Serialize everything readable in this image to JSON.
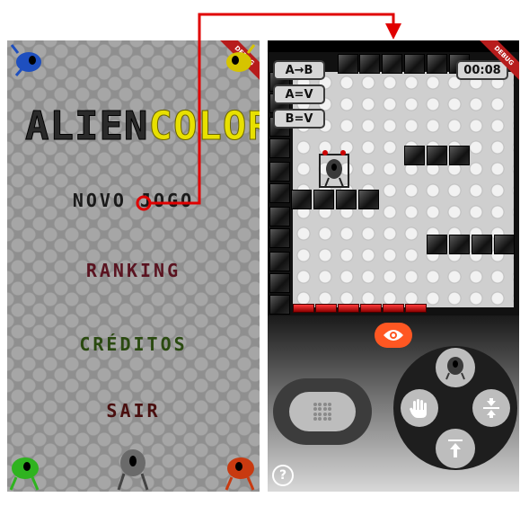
{
  "menu": {
    "logo_part1": "ALIEN",
    "logo_part2": "COLORS",
    "items": [
      {
        "label": "NOVO JOGO",
        "color": "#1a1a1a"
      },
      {
        "label": "RANKING",
        "color": "#5a1320"
      },
      {
        "label": "CRÉDITOS",
        "color": "#2a4a10"
      },
      {
        "label": "SAIR",
        "color": "#4a0f0f"
      }
    ],
    "debug_label": "DEBUG"
  },
  "game": {
    "rules": [
      "A→B",
      "A=V",
      "B=V"
    ],
    "timer": "00:08",
    "debug_label": "DEBUG"
  },
  "controls": {
    "view_icon": "eye-icon",
    "toggle_icon": "dots-icon",
    "grab_icon": "hand-icon",
    "alien_icon": "alien-icon",
    "compress_icon": "compress-icon",
    "jump_icon": "arrow-up-to-line-icon",
    "help_label": "?"
  },
  "colors": {
    "arrow": "#e00000",
    "accent": "#ff5722",
    "logo_yellow": "#e8e000"
  }
}
